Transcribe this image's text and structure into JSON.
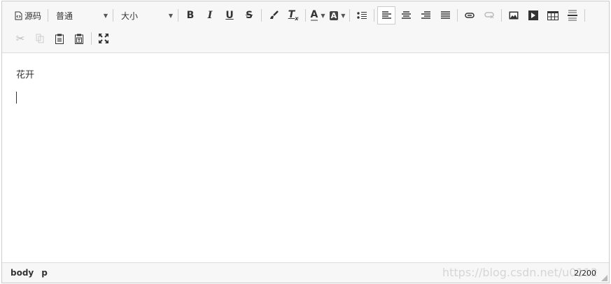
{
  "toolbar": {
    "source_label": "源码",
    "format_value": "普通",
    "size_value": "大小"
  },
  "content": {
    "paragraph": "花开"
  },
  "status": {
    "path": [
      "body",
      "p"
    ],
    "count": "2/200",
    "watermark": "https://blog.csdn.net/u0112"
  }
}
